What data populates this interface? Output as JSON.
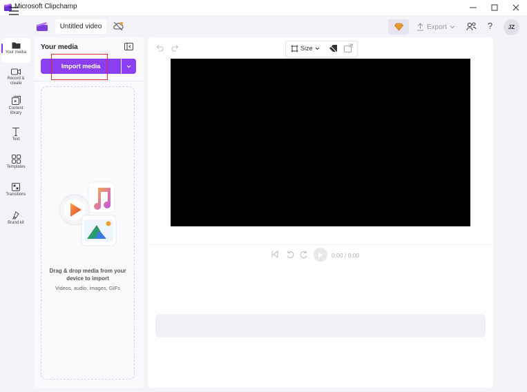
{
  "window": {
    "title": "Microsoft Clipchamp",
    "controls": [
      "minimize",
      "maximize",
      "close"
    ]
  },
  "header": {
    "project_title": "Untitled video",
    "export_label": "Export",
    "help_label": "?",
    "avatar_initials": "JZ"
  },
  "nav": {
    "items": [
      {
        "label": "Your media",
        "icon": "folder-icon",
        "active": true
      },
      {
        "label": "Record & create",
        "icon": "camera-icon",
        "active": false
      },
      {
        "label": "Content library",
        "icon": "library-icon",
        "active": false
      },
      {
        "label": "Text",
        "icon": "text-icon",
        "active": false
      },
      {
        "label": "Templates",
        "icon": "templates-icon",
        "active": false
      },
      {
        "label": "Transitions",
        "icon": "transitions-icon",
        "active": false
      },
      {
        "label": "Brand kit",
        "icon": "brand-kit-icon",
        "active": false
      }
    ]
  },
  "media_panel": {
    "title": "Your media",
    "import_label": "Import media",
    "drop_text": "Drag & drop media from your device to import",
    "drop_subtext": "Videos, audio, images, GIFs"
  },
  "canvas": {
    "size_label": "Size",
    "time": "0:00 / 0:00"
  },
  "colors": {
    "accent": "#8c3ff2",
    "highlight": "#e52a2a",
    "preview_bg": "#000000"
  }
}
